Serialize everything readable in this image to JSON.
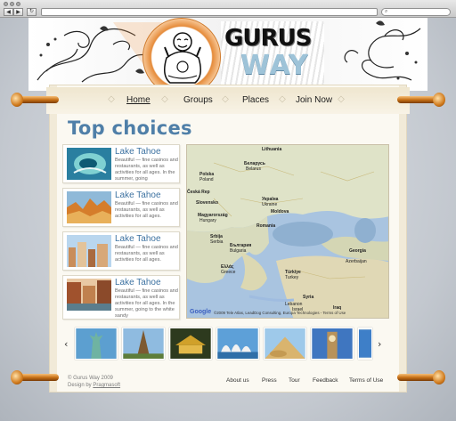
{
  "browser": {
    "back_icon": "back-arrow-icon",
    "forward_icon": "forward-arrow-icon",
    "reload_icon": "reload-icon",
    "search_icon": "magnifier-icon",
    "url": "",
    "search_placeholder": ""
  },
  "brand": {
    "logo_line1": "GURUS",
    "logo_line2": "WAY",
    "logo_colors": {
      "line1": "#111111",
      "line2": "#9ec3d8"
    }
  },
  "nav": {
    "items": [
      {
        "label": "Home",
        "active": true
      },
      {
        "label": "Groups",
        "active": false
      },
      {
        "label": "Places",
        "active": false
      },
      {
        "label": "Join Now",
        "active": false
      }
    ]
  },
  "main": {
    "heading": "Top choices",
    "heading_color": "#4f7fa8",
    "cards": [
      {
        "title": "Lake Tahoe",
        "desc": "Beautiful — fine casinos and restaurants, as well as activities for all ages. In the summer, going"
      },
      {
        "title": "Lake Tahoe",
        "desc": "Beautiful — fine casinos and restaurants, as well as activities for all ages."
      },
      {
        "title": "Lake Tahoe",
        "desc": "Beautiful — fine casinos and restaurants, as well as activities for all ages."
      },
      {
        "title": "Lake Tahoe",
        "desc": "Beautiful — fine casinos and restaurants, as well as activities for all ages. In the summer, going to the white sandy"
      }
    ]
  },
  "map": {
    "labels": [
      "Lithuania",
      "Беларусь",
      "Belarus",
      "Polska",
      "Poland",
      "Україна",
      "Ukraine",
      "Česká Rep",
      "Slovensko",
      "Moldova",
      "Magyarország",
      "Hungary",
      "Romania",
      "Srbija",
      "Serbia",
      "България",
      "Bulgaria",
      "Ελλάς",
      "Greece",
      "Türkiye",
      "Turkey",
      "Georgia",
      "Azerbaijan",
      "Syria",
      "Lebanon",
      "Israel",
      "Iraq"
    ],
    "provider": "Google",
    "attribution": "©2009 Tele Atlas, LeadDog Consulting, Europa Technologies - Terms of Use"
  },
  "gallery": {
    "prev_icon": "chevron-left-icon",
    "next_icon": "chevron-right-icon",
    "prev_label": "‹",
    "next_label": "›",
    "thumbs": [
      "statue-of-liberty",
      "eiffel-tower",
      "pagoda",
      "sydney-opera-house",
      "sphinx",
      "big-ben",
      "ocean"
    ]
  },
  "footer": {
    "copyright": "© Gurus Way 2009",
    "design_prefix": "Design by ",
    "design_link": "Pragmasoft",
    "links": [
      "About us",
      "Press",
      "Tour",
      "Feedback",
      "Terms of Use"
    ]
  }
}
